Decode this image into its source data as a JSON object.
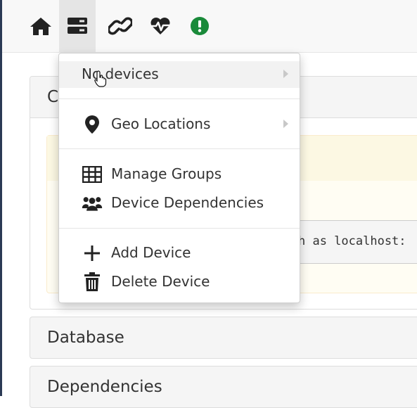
{
  "navbar": {
    "icons": [
      "home-icon",
      "server-icon",
      "link-icon",
      "heartbeat-icon",
      "alert-circle-icon"
    ],
    "alert_color": "#1a8a3a"
  },
  "panels": {
    "overview_heading_partial": "C",
    "database_heading": "Database",
    "dependencies_heading": "Dependencies",
    "code_text": "h as localhost:"
  },
  "menu": {
    "no_devices": "No devices",
    "geo_locations": "Geo Locations",
    "manage_groups": "Manage Groups",
    "device_dependencies": "Device Dependencies",
    "add_device": "Add Device",
    "delete_device": "Delete Device"
  }
}
